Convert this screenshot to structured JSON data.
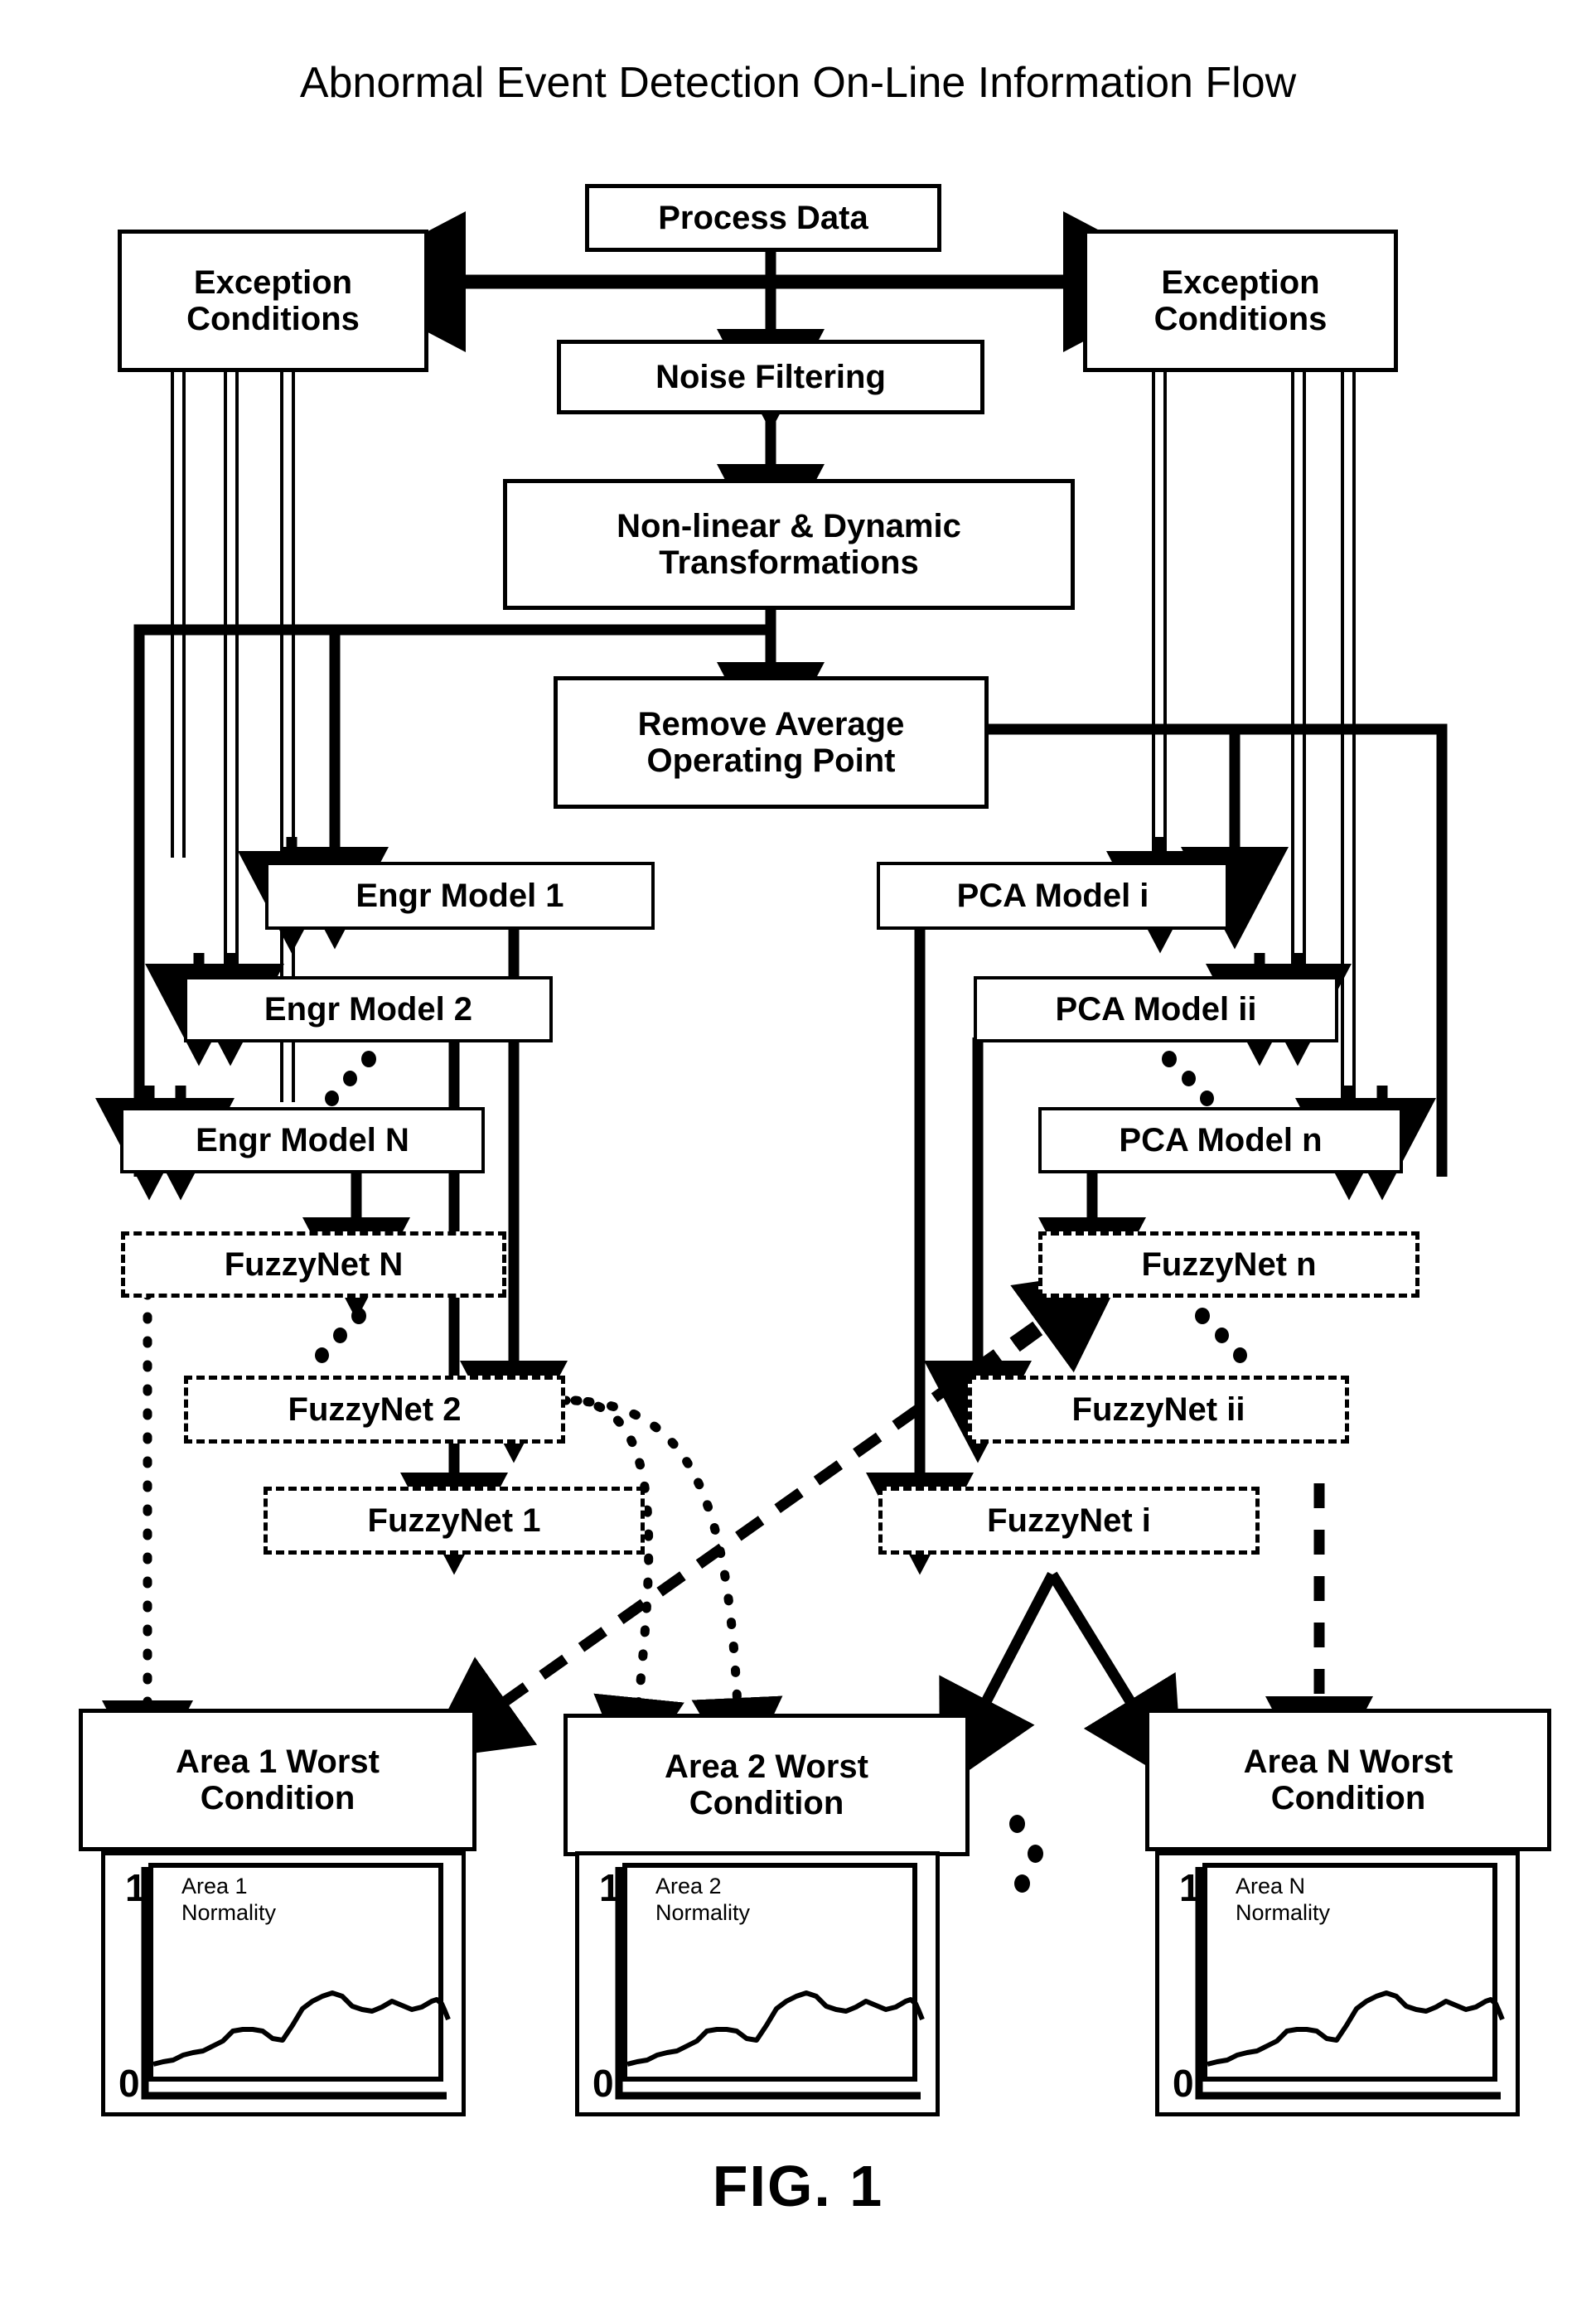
{
  "figure": {
    "title": "Abnormal Event Detection On-Line Information Flow",
    "caption": "FIG. 1"
  },
  "nodes": {
    "process_data": "Process Data",
    "noise_filtering": "Noise Filtering",
    "transformations": "Non-linear & Dynamic\nTransformations",
    "remove_average": "Remove Average\nOperating Point",
    "exception_left": "Exception\nConditions",
    "exception_right": "Exception\nConditions",
    "engr_model_1": "Engr Model 1",
    "engr_model_2": "Engr Model 2",
    "engr_model_n": "Engr Model N",
    "pca_model_i": "PCA Model i",
    "pca_model_ii": "PCA Model ii",
    "pca_model_n": "PCA Model n",
    "fuzzynet_n": "FuzzyNet N",
    "fuzzynet_2": "FuzzyNet 2",
    "fuzzynet_1": "FuzzyNet 1",
    "fuzzynet_small_n": "FuzzyNet n",
    "fuzzynet_ii": "FuzzyNet ii",
    "fuzzynet_i": "FuzzyNet i",
    "area_1_worst": "Area 1 Worst\nCondition",
    "area_2_worst": "Area 2 Worst\nCondition",
    "area_n_worst": "Area N Worst\nCondition"
  },
  "charts": [
    {
      "id": "area-1-normality",
      "label": "Area 1\nNormality",
      "y_top": "1",
      "y_bottom": "0"
    },
    {
      "id": "area-2-normality",
      "label": "Area 2\nNormality",
      "y_top": "1",
      "y_bottom": "0"
    },
    {
      "id": "area-n-normality",
      "label": "Area N\nNormality",
      "y_top": "1",
      "y_bottom": "0"
    }
  ],
  "chart_data": {
    "type": "line",
    "title": "Area Normality trend (repeated for Area 1, Area 2, Area N)",
    "xlabel": "",
    "ylabel": "Normality",
    "ylim": [
      0,
      1
    ],
    "yticks": [
      "0",
      "1"
    ],
    "grid": false,
    "legend": "none",
    "x": [
      0,
      1,
      2,
      3,
      4,
      5,
      6,
      7,
      8,
      9,
      10,
      11,
      12,
      13,
      14,
      15,
      16,
      17,
      18,
      19,
      20,
      21,
      22,
      23,
      24,
      25,
      26,
      27,
      28,
      29,
      30,
      31,
      32
    ],
    "series": [
      {
        "name": "Normality",
        "values": [
          0.1,
          0.11,
          0.12,
          0.16,
          0.17,
          0.18,
          0.21,
          0.24,
          0.3,
          0.31,
          0.31,
          0.3,
          0.26,
          0.25,
          0.33,
          0.42,
          0.47,
          0.5,
          0.52,
          0.5,
          0.45,
          0.43,
          0.42,
          0.44,
          0.47,
          0.45,
          0.43,
          0.44,
          0.47,
          0.48,
          0.46,
          0.42,
          0.38
        ]
      }
    ]
  },
  "colors": {
    "ink": "#000000",
    "paper": "#ffffff"
  },
  "ellipsis": {
    "glyph": "•",
    "meaning": "vertical ellipsis between repeated model/area elements"
  }
}
